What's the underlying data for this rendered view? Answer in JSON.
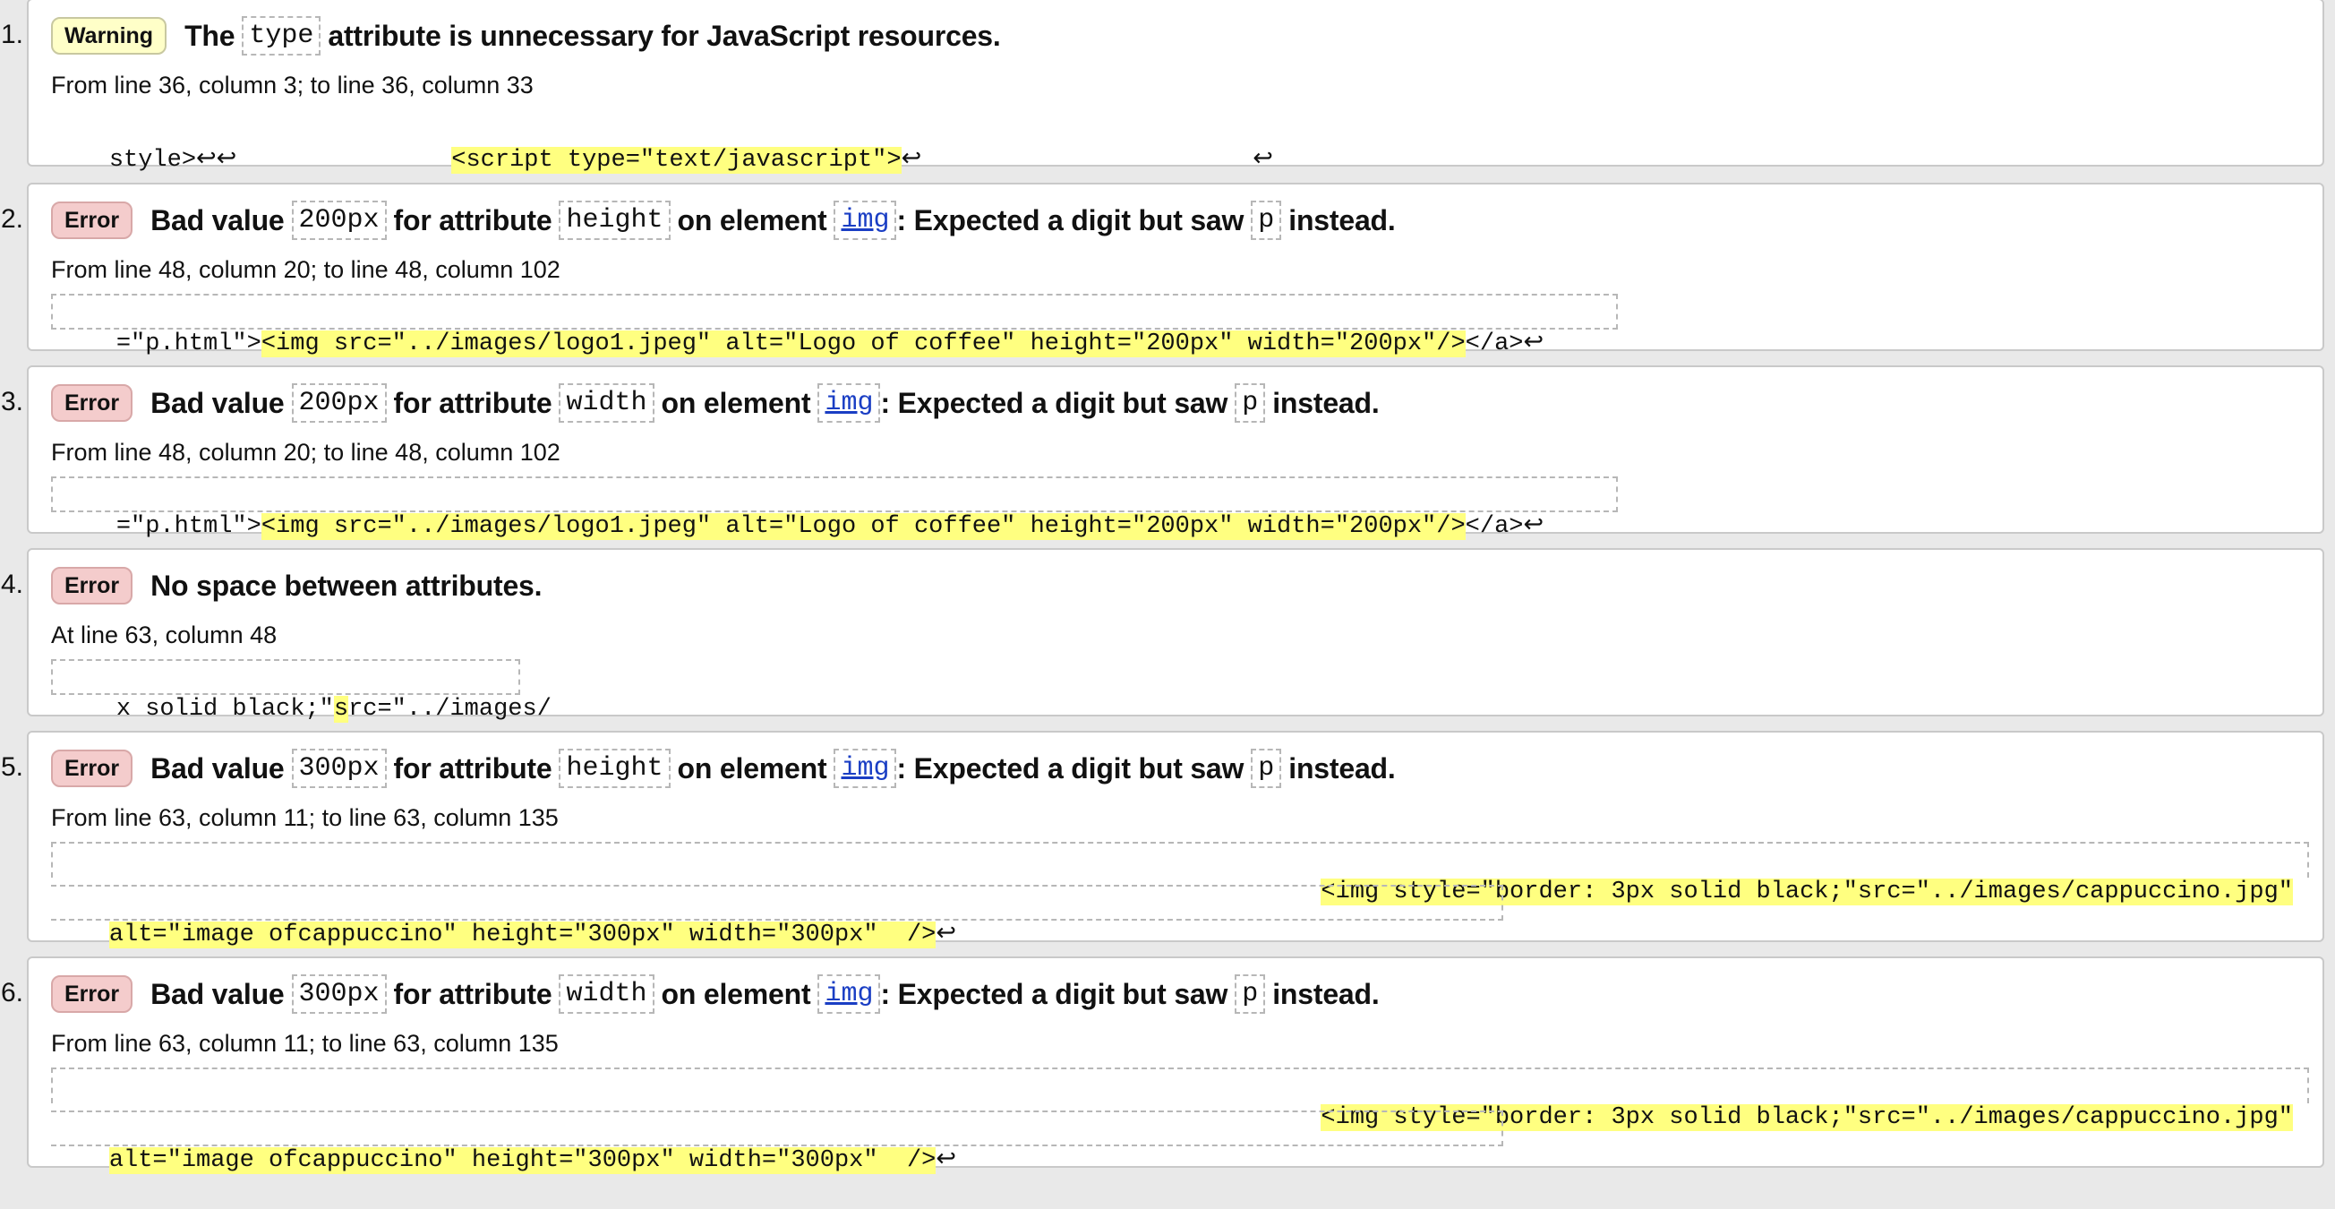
{
  "messages": [
    {
      "num": "1.",
      "type": "Warning",
      "title_parts": [
        "The",
        "type",
        "attribute is unnecessary for JavaScript resources."
      ],
      "location": "From line 36, column 3; to line 36, column 33",
      "extract_pre": "style>↩↩",
      "extract_hl": "<script type=\"text/javascript\">",
      "extract_post": "↩",
      "extract_tail": "↩"
    },
    {
      "num": "2.",
      "type": "Error",
      "title_parts": [
        "Bad value",
        "200px",
        "for attribute",
        "height",
        "on element",
        "img",
        ": Expected a digit but saw",
        "p",
        "instead."
      ],
      "location": "From line 48, column 20; to line 48, column 102",
      "extract_pre": "=\"p.html\">",
      "extract_hl": "<img src=\"../images/logo1.jpeg\" alt=\"Logo of coffee\" height=\"200px\" width=\"200px\"/>",
      "extract_post": "</a>↩"
    },
    {
      "num": "3.",
      "type": "Error",
      "title_parts": [
        "Bad value",
        "200px",
        "for attribute",
        "width",
        "on element",
        "img",
        ": Expected a digit but saw",
        "p",
        "instead."
      ],
      "location": "From line 48, column 20; to line 48, column 102",
      "extract_pre": "=\"p.html\">",
      "extract_hl": "<img src=\"../images/logo1.jpeg\" alt=\"Logo of coffee\" height=\"200px\" width=\"200px\"/>",
      "extract_post": "</a>↩"
    },
    {
      "num": "4.",
      "type": "Error",
      "title": "No space between attributes.",
      "location": "At line 63, column 48",
      "extract_pre": "x solid black;\"",
      "extract_hl": "s",
      "extract_post": "rc=\"../images/"
    },
    {
      "num": "5.",
      "type": "Error",
      "title_parts": [
        "Bad value",
        "300px",
        "for attribute",
        "height",
        "on element",
        "img",
        ": Expected a digit but saw",
        "p",
        "instead."
      ],
      "location": "From line 63, column 11; to line 63, column 135",
      "extract_line1_hl": "<img style=\"border: 3px solid black;\"src=\"../images/cappuccino.jpg\"",
      "extract_line2_hl": "alt=\"image ofcappuccino\" height=\"300px\" width=\"300px\"  />",
      "extract_line2_post": "↩"
    },
    {
      "num": "6.",
      "type": "Error",
      "title_parts": [
        "Bad value",
        "300px",
        "for attribute",
        "width",
        "on element",
        "img",
        ": Expected a digit but saw",
        "p",
        "instead."
      ],
      "location": "From line 63, column 11; to line 63, column 135",
      "extract_line1_hl": "<img style=\"border: 3px solid black;\"src=\"../images/cappuccino.jpg\"",
      "extract_line2_hl": "alt=\"image ofcappuccino\" height=\"300px\" width=\"300px\"  />",
      "extract_line2_post": "↩"
    }
  ],
  "colors": {
    "warning_badge": "#ffffc8",
    "error_badge": "#f4cccc",
    "highlight": "#ffff80",
    "link": "#1a3ec4"
  }
}
